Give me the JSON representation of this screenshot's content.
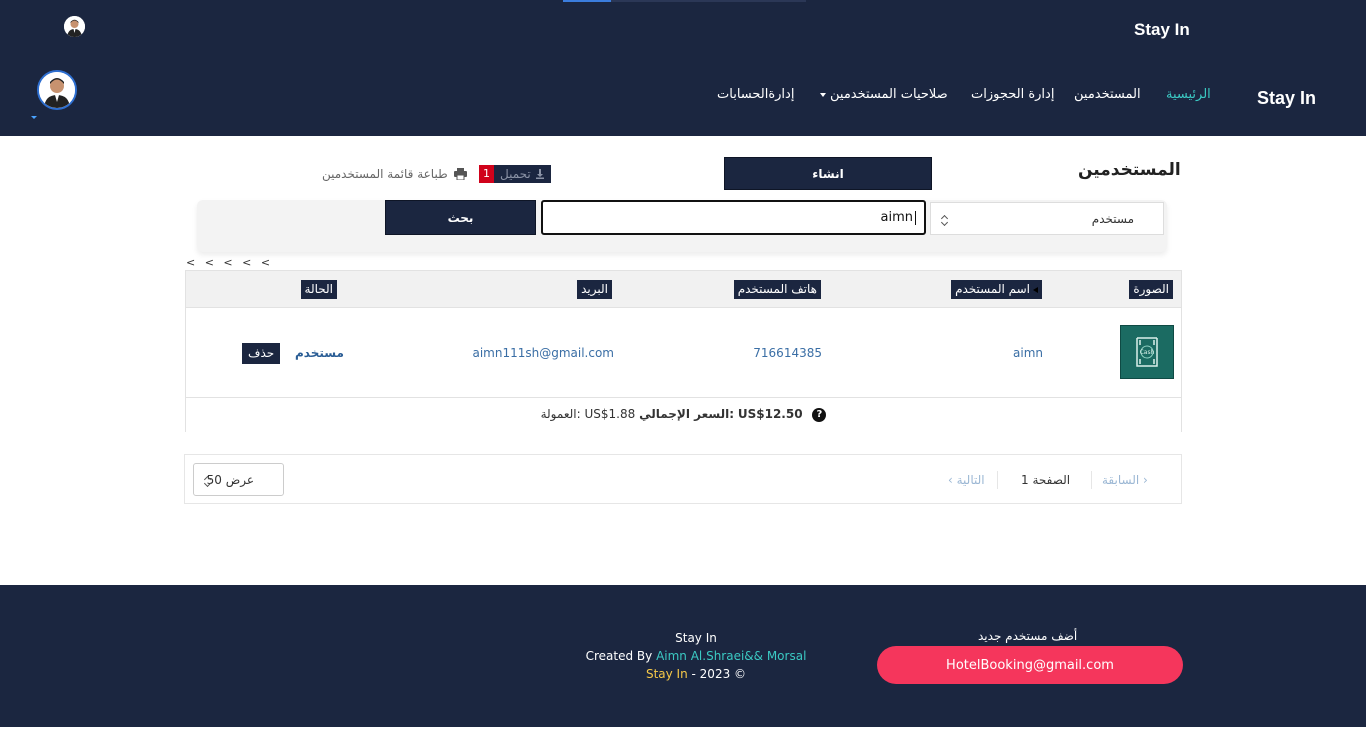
{
  "header": {
    "top_brand": "Stay In",
    "brand": "Stay In",
    "nav": [
      {
        "label": "الرئيسية",
        "active": true
      },
      {
        "label": "المستخدمين"
      },
      {
        "label": "إدارة الحجوزات"
      },
      {
        "label": "صلاحيات المستخدمين"
      },
      {
        "label": "إدارةالحسابات"
      }
    ]
  },
  "toolbar": {
    "title": "المستخدمين",
    "create_label": "انشاء",
    "download_count": "1",
    "download_label": "تحميل",
    "print_label": "طباعة قائمة المستخدمين"
  },
  "search": {
    "field_selected": "مستخدم",
    "query": "aimn",
    "button_label": "بحث"
  },
  "pager_top": "< < < < <",
  "table": {
    "columns": [
      "الصورة",
      "اسم المستخدم",
      "هاتف المستخدم",
      "البريد",
      "الحالة"
    ],
    "rows": [
      {
        "username": "aimn",
        "phone": "716614385",
        "email": "aimn111sh@gmail.com",
        "status": "مستخدم",
        "delete_label": "حذف"
      }
    ],
    "totals": {
      "commission_label": "العمولة:",
      "commission_value": "US$1.88",
      "total_label": "السعر الإجمالي:",
      "total_value": "US$12.50"
    }
  },
  "pagination": {
    "prev_label": "السابقة",
    "page_label": "الصفحة 1",
    "next_label": "التالية",
    "page_size_label": "عرض 50"
  },
  "footer": {
    "line1": "Stay In",
    "created_by": "Created By",
    "authors": "Aimn Al.Shraei&& Morsal",
    "brand": "Stay In",
    "year": "- 2023 ©",
    "add_user_title": "أضف مستخدم جديد",
    "email": "HotelBooking@gmail.com"
  },
  "colors": {
    "navy": "#1b2640",
    "accent_teal": "#3bc9c3",
    "footer_button": "#f5365c",
    "link_blue": "#3a6ea5"
  }
}
